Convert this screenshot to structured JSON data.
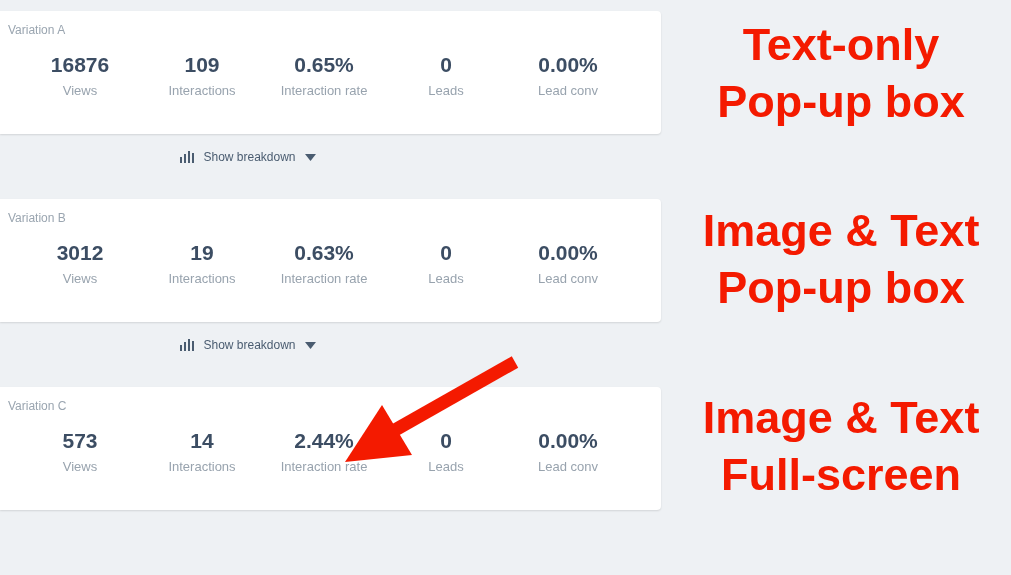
{
  "variations": [
    {
      "name": "Variation A",
      "stats": [
        {
          "value": "16876",
          "label": "Views"
        },
        {
          "value": "109",
          "label": "Interactions"
        },
        {
          "value": "0.65%",
          "label": "Interaction rate"
        },
        {
          "value": "0",
          "label": "Leads"
        },
        {
          "value": "0.00%",
          "label": "Lead conv"
        }
      ],
      "breakdown": "Show breakdown"
    },
    {
      "name": "Variation B",
      "stats": [
        {
          "value": "3012",
          "label": "Views"
        },
        {
          "value": "19",
          "label": "Interactions"
        },
        {
          "value": "0.63%",
          "label": "Interaction rate"
        },
        {
          "value": "0",
          "label": "Leads"
        },
        {
          "value": "0.00%",
          "label": "Lead conv"
        }
      ],
      "breakdown": "Show breakdown"
    },
    {
      "name": "Variation C",
      "stats": [
        {
          "value": "573",
          "label": "Views"
        },
        {
          "value": "14",
          "label": "Interactions"
        },
        {
          "value": "2.44%",
          "label": "Interaction rate"
        },
        {
          "value": "0",
          "label": "Leads"
        },
        {
          "value": "0.00%",
          "label": "Lead conv"
        }
      ]
    }
  ],
  "annotations": [
    {
      "lines": [
        "Text-only",
        "Pop-up box"
      ]
    },
    {
      "lines": [
        "Image & Text",
        "Pop-up box"
      ]
    },
    {
      "lines": [
        "Image & Text",
        "Full-screen"
      ]
    }
  ]
}
